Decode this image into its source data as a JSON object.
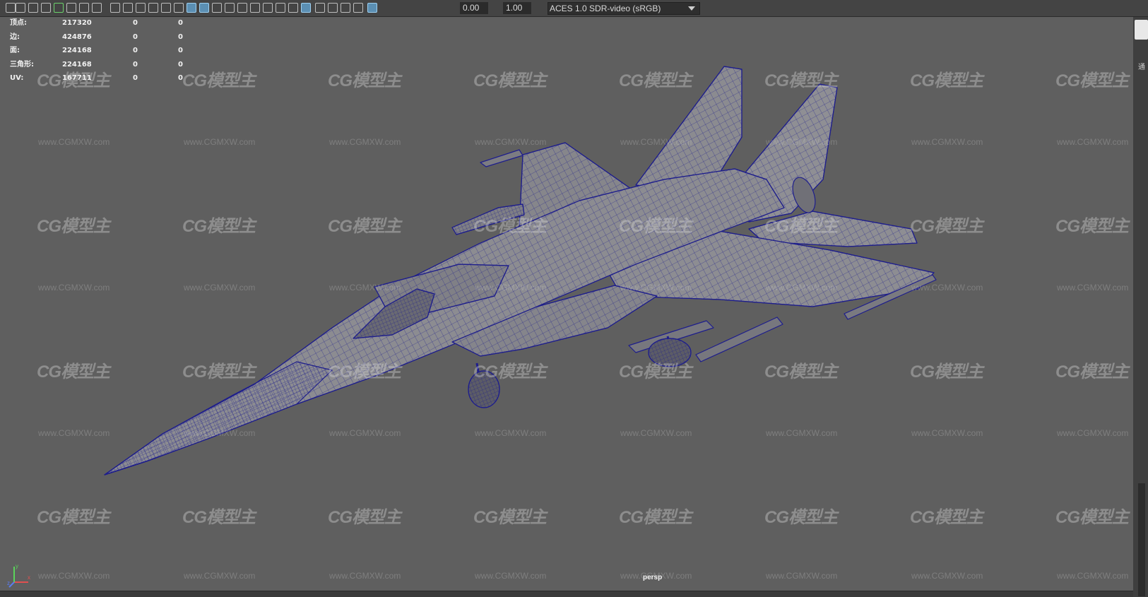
{
  "toolbar": {
    "exposure_value": "0.00",
    "gamma_value": "1.00",
    "color_space": "ACES 1.0 SDR-video (sRGB)",
    "icons": [
      "camera-icon",
      "camera-attributes-icon",
      "bookmark-icon",
      "image-plane-icon",
      "grease-pencil-icon",
      "grid-icon",
      "film-gate-icon",
      "resolution-gate-icon",
      "gate-mask-icon",
      "field-chart-icon",
      "safe-action-icon",
      "safe-title-icon",
      "wireframe-icon",
      "smooth-shade-icon",
      "wireframe-on-shaded-icon",
      "textured-icon",
      "use-all-lights-icon",
      "shadows-icon",
      "screen-space-ao-icon",
      "motion-blur-icon",
      "anti-aliasing-icon",
      "depth-of-field-icon",
      "isolate-select-icon",
      "xray-icon",
      "xray-joints-icon",
      "backface-culling-icon",
      "exposure-reset-icon",
      "gamma-reset-icon",
      "color-management-icon"
    ]
  },
  "hud": {
    "rows": [
      {
        "label": "顶点:",
        "v1": "217320",
        "v2": "0",
        "v3": "0"
      },
      {
        "label": "边:",
        "v1": "424876",
        "v2": "0",
        "v3": "0"
      },
      {
        "label": "面:",
        "v1": "224168",
        "v2": "0",
        "v3": "0"
      },
      {
        "label": "三角形:",
        "v1": "224168",
        "v2": "0",
        "v3": "0"
      },
      {
        "label": "UV:",
        "v1": "167711",
        "v2": "0",
        "v3": "0"
      }
    ]
  },
  "watermark": {
    "logo_text": "CG模型主",
    "url_text": "www.CGMXW.com"
  },
  "viewport": {
    "camera_label": "persp",
    "wire_color": "#1e1e8c",
    "fill_color": "#8a8a8e",
    "background_color": "#5f5f5f"
  },
  "axis": {
    "x": "x",
    "y": "y",
    "z": "z"
  },
  "right_panel": {
    "glyph": "通"
  }
}
